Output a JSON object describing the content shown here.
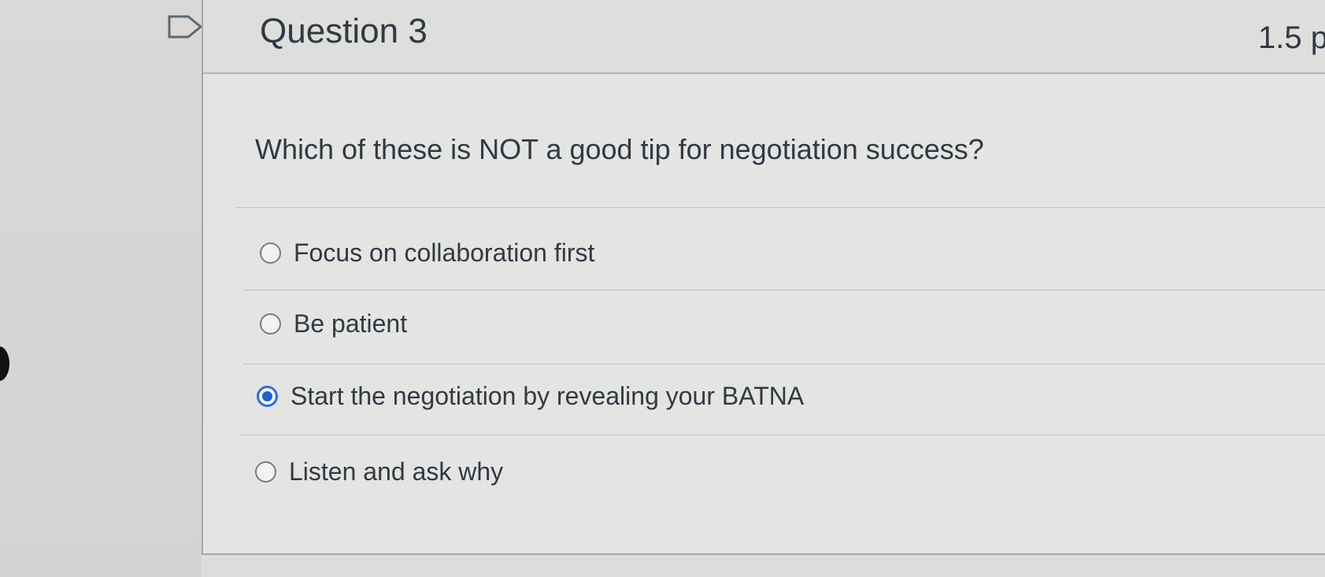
{
  "question": {
    "title": "Question 3",
    "points": "1.5 p",
    "text": "Which of these is NOT a good tip for negotiation success?",
    "flag_icon": "flag-question-icon"
  },
  "answers": [
    {
      "label": "Focus on collaboration first",
      "selected": false
    },
    {
      "label": "Be patient",
      "selected": false
    },
    {
      "label": "Start the negotiation by revealing your BATNA",
      "selected": true
    },
    {
      "label": "Listen and ask why",
      "selected": false
    }
  ],
  "colors": {
    "selected_radio": "#1b5fd0",
    "text": "#2f3a42",
    "background": "#e4e4e3"
  }
}
